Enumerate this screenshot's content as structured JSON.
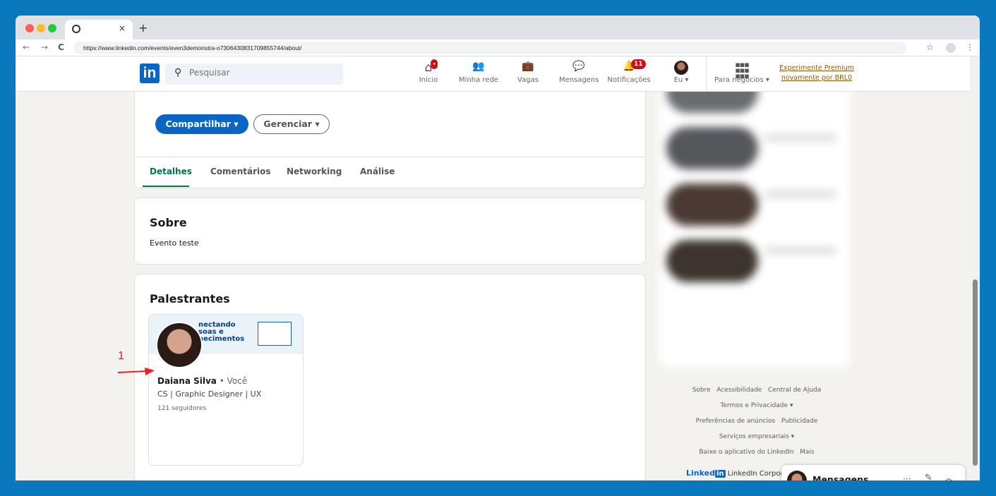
{
  "browser": {
    "url": "https://www.linkedin.com/events/even3demonstra-o7306430831709855744/about/",
    "new_tab": "+",
    "close_tab": "×",
    "back": "←",
    "forward": "→",
    "reload": "C",
    "star": "☆",
    "menu": "⋮"
  },
  "nav": {
    "logo": "in",
    "search_placeholder": "Pesquisar",
    "items": [
      {
        "label": "Início",
        "icon": "home-icon",
        "glyph": "⌂",
        "badge": "•"
      },
      {
        "label": "Minha rede",
        "icon": "people-icon",
        "glyph": "👥"
      },
      {
        "label": "Vagas",
        "icon": "briefcase-icon",
        "glyph": "💼"
      },
      {
        "label": "Mensagens",
        "icon": "message-icon",
        "glyph": "💬"
      },
      {
        "label": "Notificações",
        "icon": "bell-icon",
        "glyph": "🔔",
        "badge": "11"
      },
      {
        "label": "Eu ▾",
        "icon": "avatar"
      },
      {
        "label": "Para negócios ▾",
        "icon": "grid-icon",
        "glyph": "⋮⋮⋮"
      }
    ],
    "premium_line1": "Experimente Premium",
    "premium_line2": "novamente por BRL0"
  },
  "event": {
    "share_button": "Compartilhar ▾",
    "manage_button": "Gerenciar ▾",
    "tabs": [
      "Detalhes",
      "Comentários",
      "Networking",
      "Análise"
    ]
  },
  "about": {
    "title": "Sobre",
    "text": "Evento teste"
  },
  "speakers": {
    "title": "Palestrantes",
    "banner_text": "nectando\nsoas e\nhecimentos",
    "name": "Daiana Silva",
    "you": "• Você",
    "headline": "CS | Graphic Designer | UX",
    "followers": "121 seguidores"
  },
  "annotation": {
    "number": "1"
  },
  "footer": {
    "line1": [
      "Sobre",
      "Acessibilidade",
      "Central de Ajuda"
    ],
    "line2": "Termos e Privacidade ▾",
    "line3": [
      "Preferências de anúncios",
      "Publicidade"
    ],
    "line4": "Serviços empresariais ▾",
    "line5": [
      "Baixe o aplicativo do LinkedIn",
      "Mais"
    ],
    "brand": "Linked",
    "brand_in": "in",
    "corp": "LinkedIn Corpora"
  },
  "messaging": {
    "title": "Mensagens",
    "more": "···",
    "compose": "✎",
    "collapse": "︿"
  },
  "colors": {
    "linkedin_blue": "#0a66c2",
    "green_tab": "#01754f",
    "badge_red": "#cc1016",
    "premium_gold": "#915907",
    "desktop_blue": "#0a78bd"
  }
}
